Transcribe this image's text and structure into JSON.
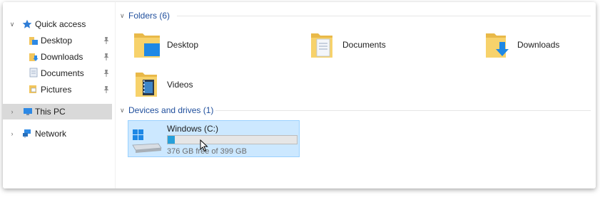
{
  "nav": {
    "quick_access": {
      "label": "Quick access",
      "icon": "star-icon",
      "expanded": true
    },
    "pinned": [
      {
        "label": "Desktop",
        "icon": "desktop-folder-icon"
      },
      {
        "label": "Downloads",
        "icon": "downloads-folder-icon"
      },
      {
        "label": "Documents",
        "icon": "documents-folder-icon"
      },
      {
        "label": "Pictures",
        "icon": "pictures-folder-icon"
      }
    ],
    "this_pc": {
      "label": "This PC",
      "icon": "computer-icon",
      "selected": true
    },
    "network": {
      "label": "Network",
      "icon": "network-icon"
    }
  },
  "content": {
    "folders_header": "Folders (6)",
    "folders": [
      {
        "label": "Desktop",
        "icon": "desktop-folder-icon"
      },
      {
        "label": "Documents",
        "icon": "documents-folder-icon"
      },
      {
        "label": "Downloads",
        "icon": "downloads-folder-icon"
      },
      {
        "label": "Videos",
        "icon": "videos-folder-icon"
      }
    ],
    "devices_header": "Devices and drives (1)",
    "drive": {
      "name": "Windows (C:)",
      "space_text": "376 GB free of 399 GB",
      "used_fraction": 0.0576,
      "icon": "windows-drive-icon"
    }
  },
  "colors": {
    "accent": "#26a0da",
    "group_header": "#1f4e9c",
    "selection": "#cce8ff",
    "nav_selected": "#d9d9d9",
    "folder": "#f5c542"
  }
}
